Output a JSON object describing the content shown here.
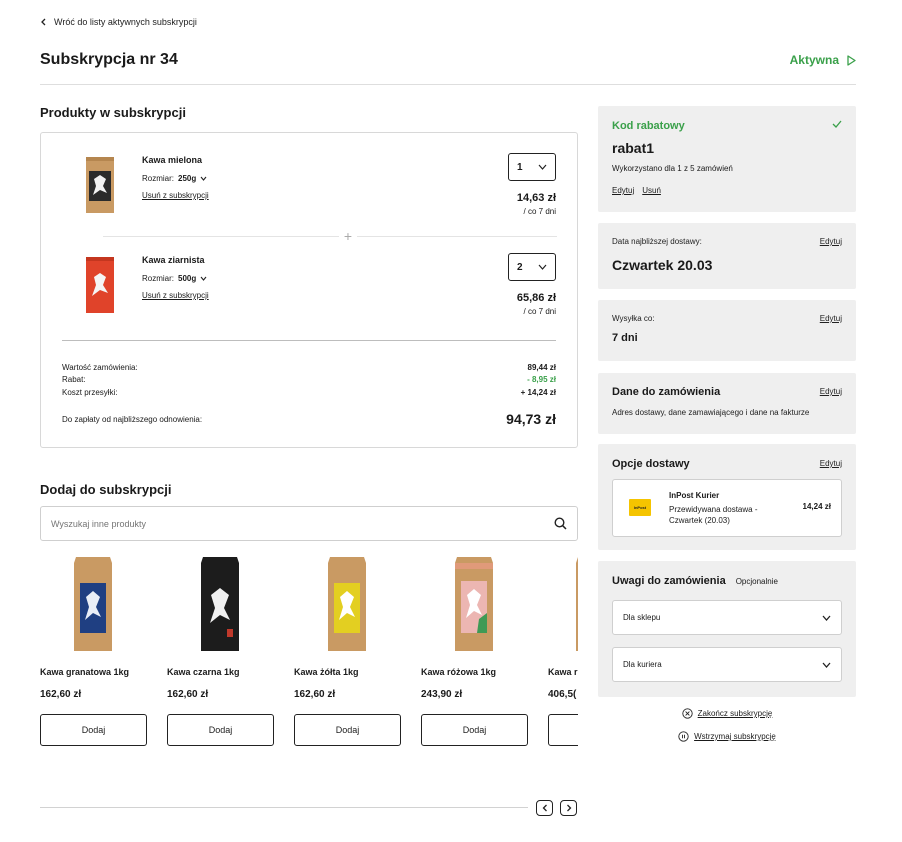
{
  "nav": {
    "back_label": "Wróć do listy aktywnych subskrypcji"
  },
  "header": {
    "title": "Subskrypcja nr 34",
    "status": "Aktywna",
    "status_color": "#3aa04a"
  },
  "products_section": {
    "title": "Produkty w subskrypcji",
    "size_label": "Rozmiar:",
    "remove_label": "Usuń z subskrypcji",
    "items": [
      {
        "name": "Kawa mielona",
        "size": "250g",
        "qty": "1",
        "price": "14,63 zł",
        "freq": "/ co 7 dni",
        "bag_color": "#2b2b2b"
      },
      {
        "name": "Kawa ziarnista",
        "size": "500g",
        "qty": "2",
        "price": "65,86 zł",
        "freq": "/ co 7 dni",
        "bag_color": "#e0432a"
      }
    ]
  },
  "summary": {
    "order_value_label": "Wartość zamówienia:",
    "order_value": "89,44 zł",
    "discount_label": "Rabat:",
    "discount": "- 8,95 zł",
    "shipping_label": "Koszt przesyłki:",
    "shipping": "+ 14,24 zł",
    "total_label": "Do zapłaty od najbliższego odnowienia:",
    "total": "94,73 zł"
  },
  "add_section": {
    "title": "Dodaj do subskrypcji",
    "search_placeholder": "Wyszukaj inne produkty",
    "add_label": "Dodaj",
    "products": [
      {
        "name": "Kawa granatowa 1kg",
        "price": "162,60 zł",
        "label_color": "#1f3f82"
      },
      {
        "name": "Kawa czarna 1kg",
        "price": "162,60 zł",
        "label_color": "#1c1c1c"
      },
      {
        "name": "Kawa żółta 1kg",
        "price": "162,60 zł",
        "label_color": "#e3cf21"
      },
      {
        "name": "Kawa różowa 1kg",
        "price": "243,90 zł",
        "label_color": "#ecb6b2"
      },
      {
        "name": "Kawa r",
        "price": "406,5(",
        "label_color": "#c9a27a"
      }
    ]
  },
  "coupon": {
    "title": "Kod rabatowy",
    "code": "rabat1",
    "usage": "Wykorzystano dla 1 z 5 zamówień",
    "edit_label": "Edytuj",
    "remove_label": "Usuń"
  },
  "delivery_date": {
    "label": "Data najbliższej dostawy:",
    "value": "Czwartek 20.03",
    "edit_label": "Edytuj"
  },
  "frequency": {
    "label": "Wysyłka co:",
    "value": "7 dni",
    "edit_label": "Edytuj"
  },
  "order_data": {
    "title": "Dane do zamówienia",
    "desc": "Adres dostawy, dane zamawiającego i dane na fakturze",
    "edit_label": "Edytuj"
  },
  "delivery_options": {
    "title": "Opcje dostawy",
    "edit_label": "Edytuj",
    "courier_name": "InPost Kurier",
    "courier_desc": "Przewidywana dostawa - Czwartek (20.03)",
    "courier_price": "14,24 zł",
    "logo_text": "InPost",
    "logo_color": "#f5c400"
  },
  "notes": {
    "title": "Uwagi do zamówienia",
    "optional": "Opcjonalnie",
    "shop_label": "Dla sklepu",
    "courier_label": "Dla kuriera"
  },
  "actions": {
    "end_label": "Zakończ subskrypcję",
    "pause_label": "Wstrzymaj subskrypcję"
  }
}
